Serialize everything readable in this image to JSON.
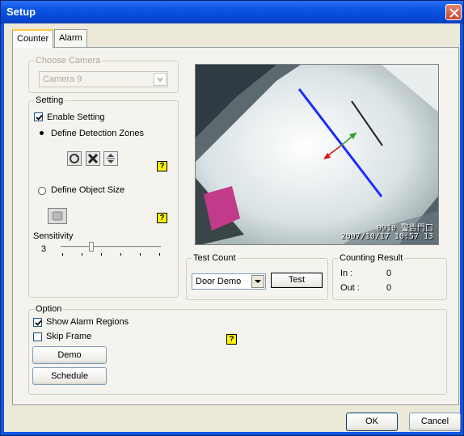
{
  "window": {
    "title": "Setup"
  },
  "tabs": [
    "Counter",
    "Alarm"
  ],
  "choose_camera": {
    "label": "Choose Camera",
    "value": "Camera 9"
  },
  "setting": {
    "label": "Setting",
    "enable_setting": "Enable Setting",
    "define_detection_zones": "Define Detection Zones",
    "define_object_size": "Define Object Size",
    "sensitivity_label": "Sensitivity",
    "sensitivity_value": "3",
    "sensitivity_level": 3,
    "sensitivity_max": 10
  },
  "video": {
    "overlay_line1": "0910 警告門口",
    "overlay_line2": "2007/10/17 10:57 13"
  },
  "test_count": {
    "label": "Test Count",
    "value": "Door Demo",
    "test_button": "Test"
  },
  "counting_result": {
    "label": "Counting Result",
    "in_label": "In :",
    "in_value": "0",
    "out_label": "Out :",
    "out_value": "0"
  },
  "option": {
    "label": "Option",
    "show_alarm_regions": "Show Alarm Regions",
    "skip_frame": "Skip Frame",
    "demo_button": "Demo",
    "schedule_button": "Schedule"
  },
  "footer": {
    "ok": "OK",
    "cancel": "Cancel"
  },
  "help_glyph": "?",
  "colors": {
    "title_bar": "#0A55E3",
    "detection_line": "#1A2BFF",
    "arrow_in": "#2DA02D",
    "arrow_out": "#E01010"
  }
}
